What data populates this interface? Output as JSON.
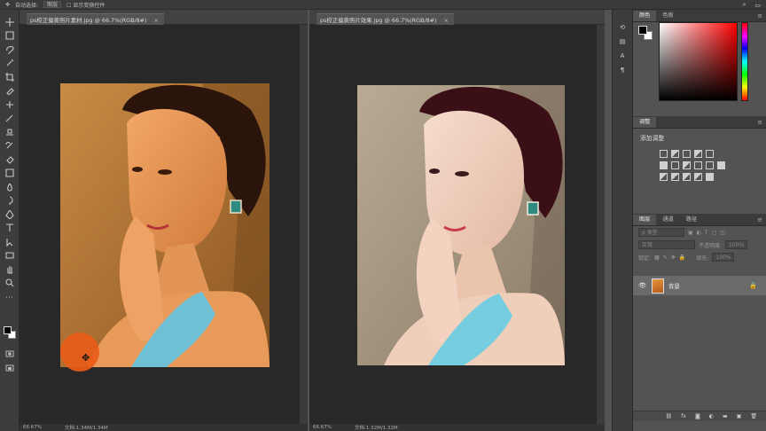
{
  "options_bar": {
    "tool_label": "自动选择:",
    "tool_dropdown": "图层",
    "show_transform": "显示变换控件",
    "icons": [
      "move-icon",
      "search-icon",
      "workspace-icon"
    ]
  },
  "toolbar": {
    "tools": [
      "move-icon",
      "marquee-icon",
      "lasso-icon",
      "quick-select-icon",
      "crop-icon",
      "eyedropper-icon",
      "healing-icon",
      "brush-icon",
      "stamp-icon",
      "history-brush-icon",
      "eraser-icon",
      "gradient-icon",
      "blur-icon",
      "dodge-icon",
      "pen-icon",
      "type-icon",
      "path-select-icon",
      "rectangle-icon",
      "hand-icon",
      "zoom-icon",
      "more-icon"
    ]
  },
  "documents": [
    {
      "tab_title": "ps校正偏黄照片素材.jpg @ 66.7%(RGB/8#)",
      "close": "×",
      "zoom": "66.67%",
      "doc_size": "文档:1.34M/1.34M",
      "tone": "warm"
    },
    {
      "tab_title": "ps校正偏黄照片效果.jpg @ 66.7%(RGB/8#)",
      "close": "×",
      "zoom": "66.67%",
      "doc_size": "文档:1.32M/1.32M",
      "tone": "corrected"
    }
  ],
  "panels": {
    "color_tabs": [
      "颜色",
      "色板"
    ],
    "adjust_tab": "调整",
    "adjust_title": "添加调整",
    "layers_tabs": [
      "图层",
      "通道",
      "路径"
    ],
    "filter_placeholder": "ρ 类型",
    "blend_mode": "正常",
    "opacity_label": "不透明度:",
    "opacity_value": "100%",
    "lock_label": "锁定:",
    "fill_label": "填充:",
    "fill_value": "100%",
    "layer_name": "背景",
    "footer_icons": [
      "link-icon",
      "fx-icon",
      "mask-icon",
      "adjustment-icon",
      "folder-icon",
      "new-layer-icon",
      "trash-icon"
    ],
    "fx_label": "fx"
  },
  "colors": {
    "accent_cursor": "#e85c18",
    "fg": "#000000",
    "bg": "#ffffff"
  }
}
